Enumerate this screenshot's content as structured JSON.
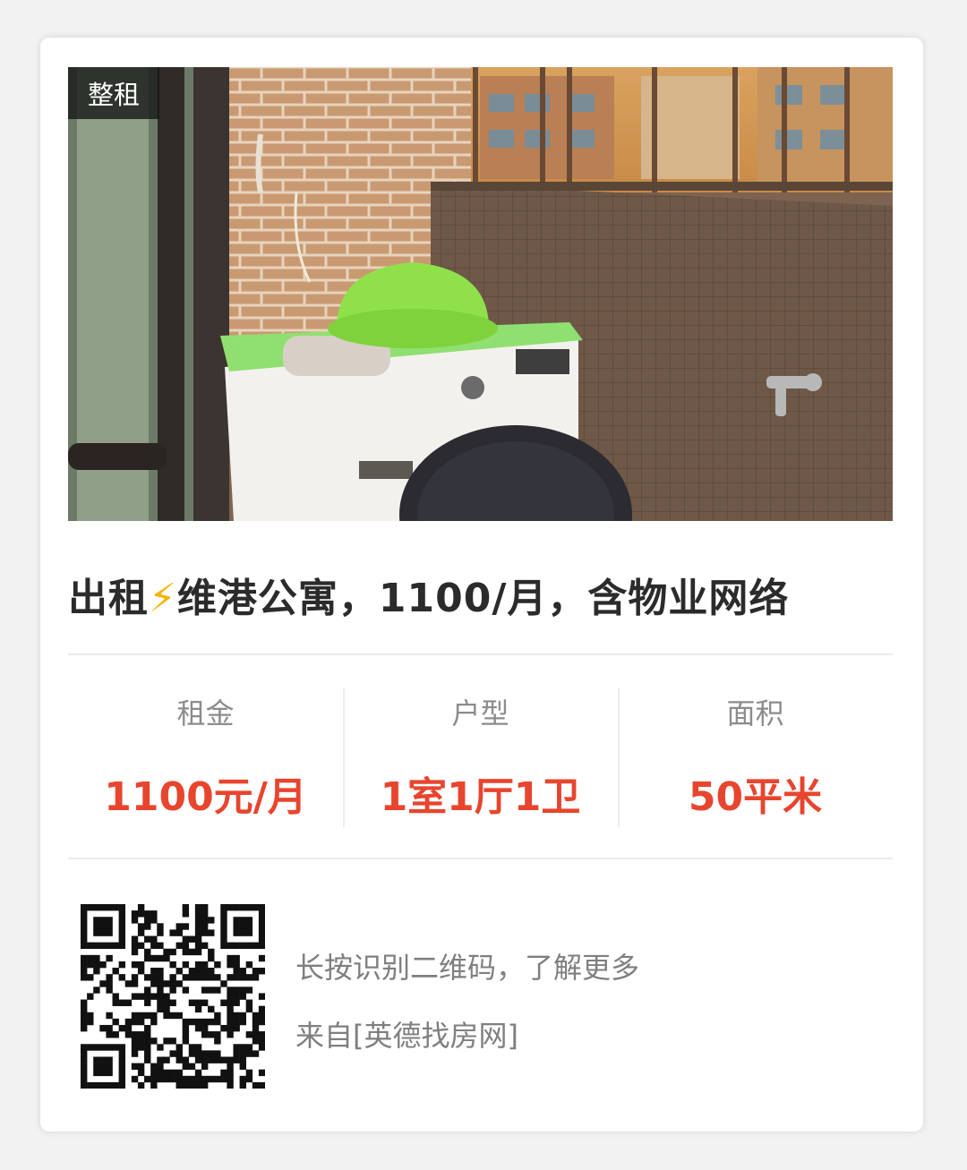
{
  "listing": {
    "tag": "整租",
    "title_start": "出租",
    "title_icon": "⚡",
    "title_end": "维港公寓，1100/月，含物业网络",
    "photo_icon": "apartment-balcony-photo"
  },
  "stats": [
    {
      "label": "租金",
      "value": "1100元/月"
    },
    {
      "label": "户型",
      "value": "1室1厅1卫"
    },
    {
      "label": "面积",
      "value": "50平米"
    }
  ],
  "footer": {
    "qr_icon": "qr-code-icon",
    "hint": "长按识别二维码，了解更多",
    "source": "来自[英德找房网]"
  },
  "colors": {
    "accent": "#e8452e",
    "tag_bg": "#1a1a1a",
    "title": "#2b2b2b",
    "muted": "#8c8c8c",
    "bolt": "#f5b301"
  }
}
